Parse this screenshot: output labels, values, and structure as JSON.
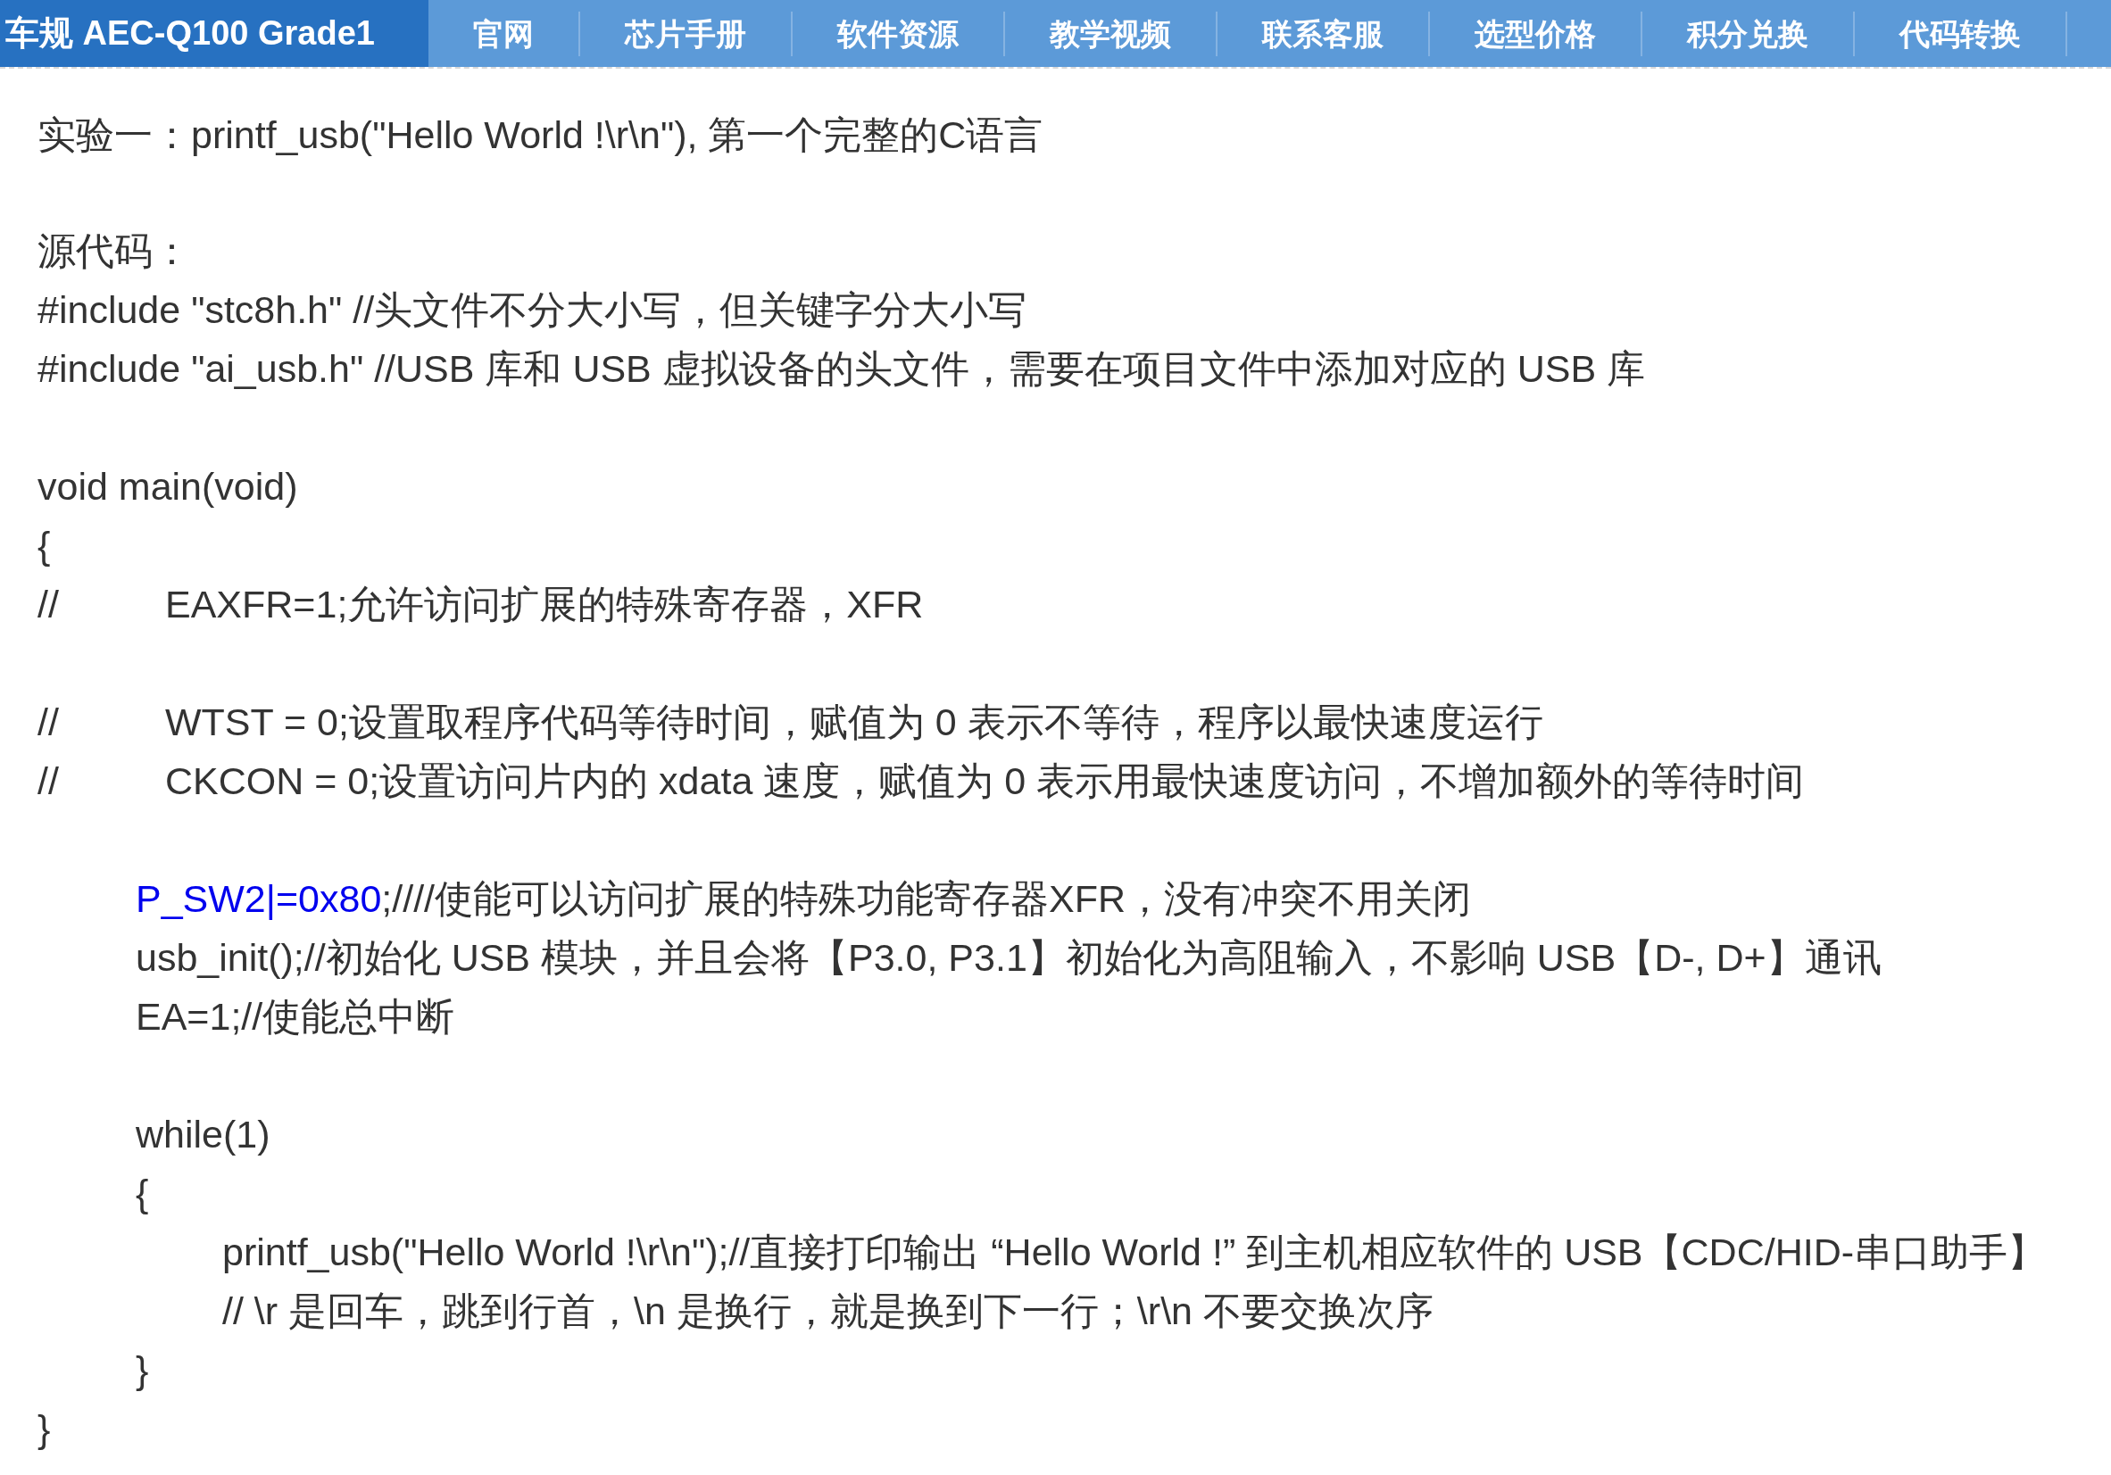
{
  "top_bar": {
    "brand": "车规 AEC-Q100 Grade1",
    "nav": [
      {
        "label": "官网"
      },
      {
        "label": "芯片手册"
      },
      {
        "label": "软件资源"
      },
      {
        "label": "教学视频"
      },
      {
        "label": "联系客服"
      },
      {
        "label": "选型价格"
      },
      {
        "label": "积分兑换"
      },
      {
        "label": "代码转换"
      }
    ]
  },
  "content": {
    "heading": "实验一：printf_usb(\"Hello World !\\r\\n\"), 第一个完整的C语言",
    "source_label": "源代码：",
    "lines": [
      {
        "kind": "code",
        "text": "#include \"stc8h.h\"  //头文件不分大小写，但关键字分大小写"
      },
      {
        "kind": "code",
        "text": "#include \"ai_usb.h\" //USB 库和 USB 虚拟设备的头文件，需要在项目文件中添加对应的 USB 库"
      },
      {
        "kind": "code",
        "text": "void main(void)",
        "space_before": true
      },
      {
        "kind": "code",
        "text": "{"
      },
      {
        "kind": "comment",
        "marker": "//",
        "text": "EAXFR=1;允许访问扩展的特殊寄存器，XFR"
      },
      {
        "kind": "comment",
        "marker": "//",
        "text": "WTST = 0;设置取程序代码等待时间，赋值为 0 表示不等待，程序以最快速度运行",
        "space_before": true
      },
      {
        "kind": "comment",
        "marker": "//",
        "text": "CKCON = 0;设置访问片内的 xdata 速度，赋值为 0 表示用最快速度访问，不增加额外的等待时间"
      },
      {
        "kind": "block",
        "space_before": true,
        "children": [
          {
            "kind": "code",
            "highlight": "P_SW2|=0x80",
            "text": ";////使能可以访问扩展的特殊功能寄存器XFR，没有冲突不用关闭"
          },
          {
            "kind": "code",
            "text": "usb_init();//初始化 USB 模块，并且会将【P3.0, P3.1】初始化为高阻输入，不影响 USB【D-, D+】通讯"
          },
          {
            "kind": "code",
            "text": "EA=1;//使能总中断"
          },
          {
            "kind": "code",
            "text": "while(1)",
            "space_before": true
          },
          {
            "kind": "code",
            "text": "{"
          },
          {
            "kind": "block",
            "children": [
              {
                "kind": "code",
                "text": "printf_usb(\"Hello World !\\r\\n\");//直接打印输出 “Hello World !” 到主机相应软件的 USB【CDC/HID-串口助手】"
              },
              {
                "kind": "code",
                "text": "// \\r 是回车，跳到行首，\\n 是换行，就是换到下一行；\\r\\n 不要交换次序"
              }
            ]
          },
          {
            "kind": "code",
            "text": "}"
          }
        ]
      },
      {
        "kind": "code",
        "text": "}"
      }
    ]
  }
}
